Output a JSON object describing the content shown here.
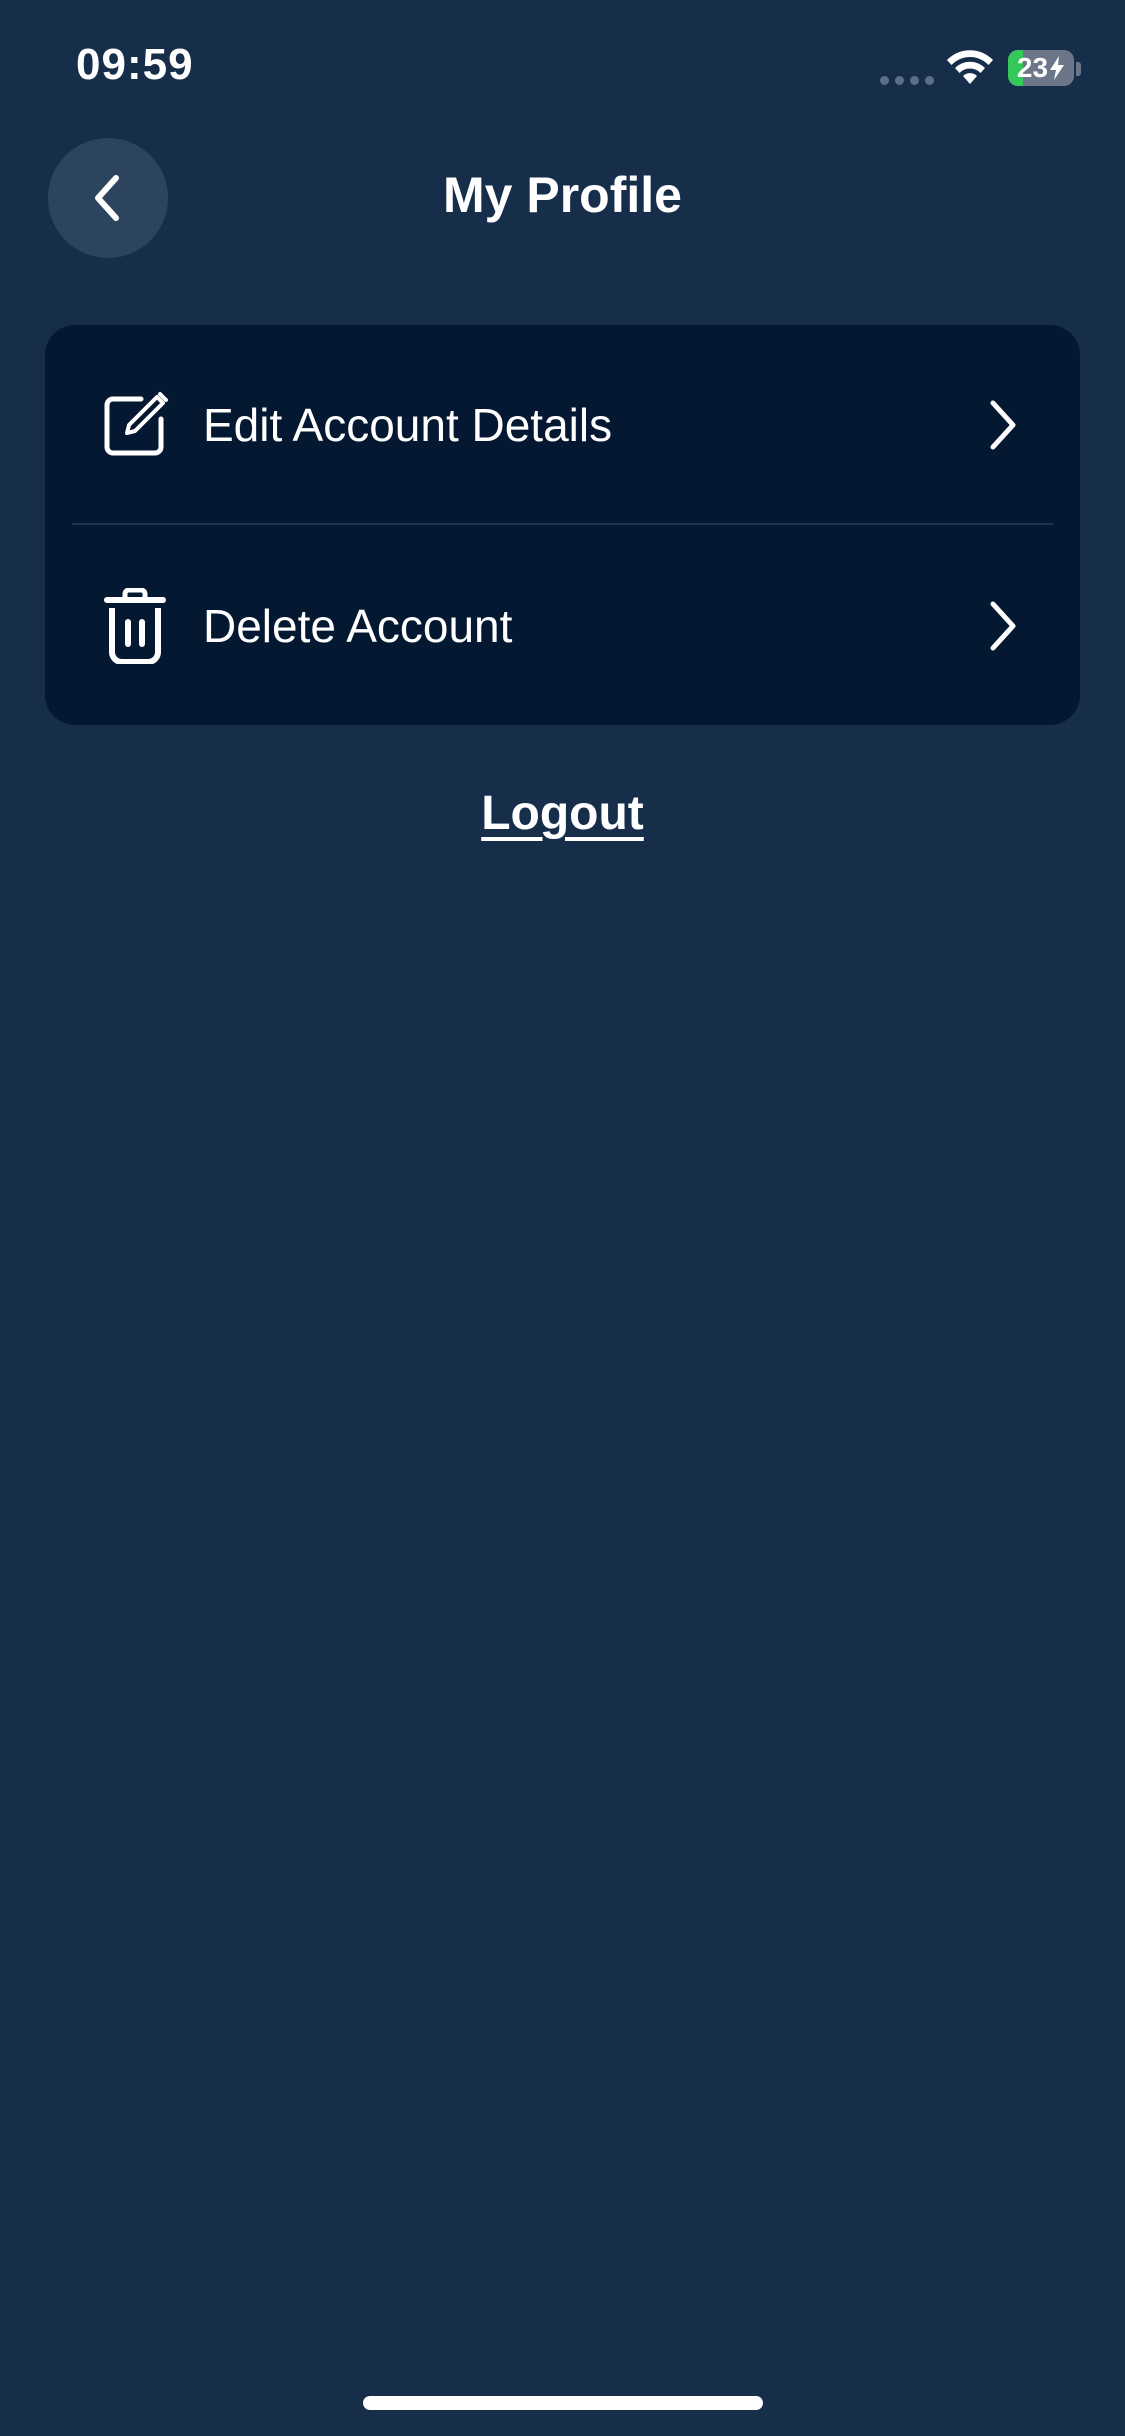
{
  "status_bar": {
    "time": "09:59",
    "battery_level": "23",
    "battery_fraction": 0.23,
    "battery_charging": true,
    "battery_color": "#34c759"
  },
  "header": {
    "title": "My Profile",
    "back_icon": "chevron-left-icon"
  },
  "menu": {
    "items": [
      {
        "label": "Edit Account Details",
        "icon": "edit-icon",
        "trailing_icon": "chevron-right-icon"
      },
      {
        "label": "Delete Account",
        "icon": "trash-icon",
        "trailing_icon": "chevron-right-icon"
      }
    ]
  },
  "logout": {
    "label": "Logout"
  },
  "colors": {
    "background": "#172e4b",
    "card": "#051831",
    "back_button": "#2d445f",
    "text": "#ffffff"
  }
}
